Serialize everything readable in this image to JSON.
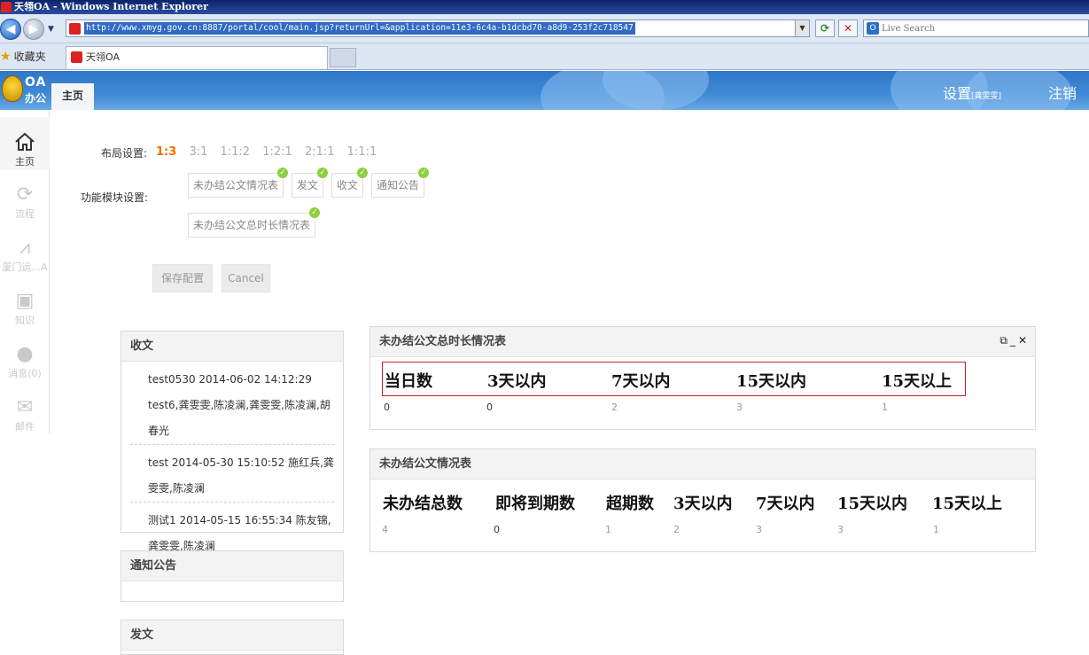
{
  "browser": {
    "window_title": "天翎OA - Windows Internet Explorer",
    "url": "http://www.xmyg.gov.cn:8887/portal/cool/main.jsp?returnUrl=&application=11e3-6c4a-b1dcbd70-a8d9-253f2c718547",
    "search_placeholder": "Live Search",
    "favorites_label": "收藏夹",
    "tab_title": "天翎OA"
  },
  "header": {
    "logo_top": "OA",
    "logo_bottom": "办公",
    "home_tab": "主页",
    "settings_label": "设置",
    "settings_user": "[龚雯雯]",
    "logout_label": "注销"
  },
  "sidebar": {
    "items": [
      {
        "label": "主页",
        "icon": "home-icon"
      },
      {
        "label": "流程",
        "icon": "refresh-icon"
      },
      {
        "label": "厦门运...A",
        "icon": "compass-icon"
      },
      {
        "label": "知识",
        "icon": "knowledge-icon"
      },
      {
        "label": "消息(0)",
        "icon": "user-icon"
      },
      {
        "label": "邮件",
        "icon": "mail-icon"
      }
    ]
  },
  "layout_settings": {
    "label": "布局设置:",
    "options": [
      "1:3",
      "3:1",
      "1:1:2",
      "1:2:1",
      "2:1:1",
      "1:1:1"
    ],
    "selected": "1:3"
  },
  "module_settings": {
    "label": "功能模块设置:",
    "modules": [
      "未办结公文情况表",
      "发文",
      "收文",
      "通知公告",
      "未办结公文总时长情况表"
    ]
  },
  "buttons": {
    "save": "保存配置",
    "cancel": "Cancel"
  },
  "panels": {
    "shouwen": {
      "title": "收文",
      "items": [
        "test0530 2014-06-02 14:12:29 test6,龚雯雯,陈凌澜,龚雯雯,陈凌澜,胡春光",
        "test 2014-05-30 15:10:52 施红兵,龚雯雯,陈凌澜",
        "测试1 2014-05-15 16:55:34 陈友锦,龚雯雯,陈凌澜"
      ]
    },
    "notice": {
      "title": "通知公告"
    },
    "fawen": {
      "title": "发文"
    },
    "duration": {
      "title": "未办结公文总时长情况表",
      "headers": [
        "当日数",
        "3天以内",
        "7天以内",
        "15天以内",
        "15天以上"
      ],
      "values": [
        "0",
        "0",
        "2",
        "3",
        "1"
      ]
    },
    "status": {
      "title": "未办结公文情况表",
      "headers": [
        "未办结总数",
        "即将到期数",
        "超期数",
        "3天以内",
        "7天以内",
        "15天以内",
        "15天以上"
      ],
      "values": [
        "4",
        "0",
        "1",
        "2",
        "3",
        "3",
        "1"
      ]
    }
  }
}
